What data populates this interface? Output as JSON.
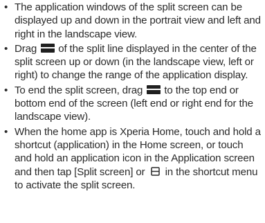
{
  "bullet": "•",
  "items": [
    {
      "text": "The application windows of the split screen can be displayed up and down in the portrait view and left and right in the landscape view."
    },
    {
      "before": "Drag ",
      "icon": "split-line-handle-icon",
      "after": " of the split line displayed in the center of the split screen up or down (in the landscape view, left or right) to change the range of the application display."
    },
    {
      "before": "To end the split screen, drag ",
      "icon": "split-line-handle-icon",
      "after": " to the top end or bottom end of the screen (left end or right end for the landscape view)."
    },
    {
      "before": "When the home app is Xperia Home, touch and hold a shortcut (application) in the Home screen, or touch and hold an application icon in the Application screen and then tap [Split screen] or ",
      "icon": "split-screen-icon",
      "after": " in the shortcut menu to activate the split screen."
    }
  ]
}
